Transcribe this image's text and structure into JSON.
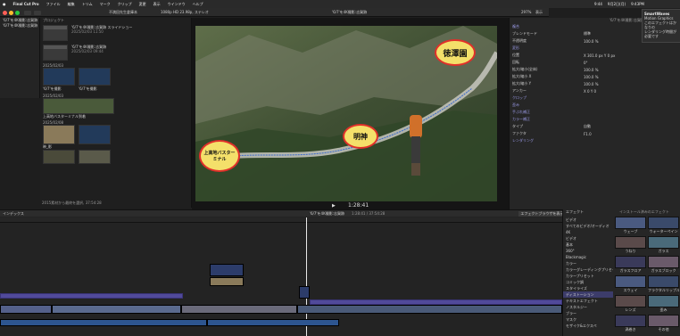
{
  "menubar": {
    "apple_icon": "apple-icon",
    "app": "Final Cut Pro",
    "items": [
      "ファイル",
      "編集",
      "トリム",
      "マーク",
      "クリップ",
      "変更",
      "表示",
      "ウインドウ",
      "ヘルプ"
    ],
    "status_items": [
      "9:44",
      "9月2日(月)",
      "9:43PM"
    ]
  },
  "toolbar": {
    "viewer_label": "不満田先生倉庫本",
    "resolution": "1080p HD 23.98p, ステレオ",
    "clip_title": "'6/7'を4K撮影:志賀跡",
    "zoom": "297%",
    "view_menu": "表示"
  },
  "library": {
    "items": [
      "'6/7'を4K撮影:志賀跡",
      "'6/7'を4K撮影:志賀跡"
    ]
  },
  "browser": {
    "section_project": "プロジェクト",
    "project_name": "'6/7'を4K撮影:志賀跡 スライドショー",
    "project_date": "2025/02/03 11:50",
    "project2_name": "'6/7'を4K撮影:志賀跡",
    "project2_date": "2025/02/03 09:44",
    "date_groups": [
      "2025/02/03",
      "2025/02/03",
      "2025/02/08"
    ],
    "clip_labels": [
      "'6/7'を撮影",
      "'6/7'を撮影",
      "上高地バスターミナル到着",
      "映_影"
    ],
    "footer": "2015素材から最終を選択, 37:54:28"
  },
  "viewer": {
    "label_tokusawa": "徳澤園",
    "label_myojin": "明神",
    "label_kamikochi": "上高地バスターミナル",
    "timecode": "1:28:41"
  },
  "inspector": {
    "title": "'6/7'を4K撮影:志賀跡",
    "rows": [
      {
        "label": "複合",
        "value": ""
      },
      {
        "label": "ブレンドモード",
        "value": "標準"
      },
      {
        "label": "不透明度",
        "value": "100.0 %"
      },
      {
        "label": "変形",
        "value": ""
      },
      {
        "label": "位置",
        "value": "X 301.0 px    Y 0 px"
      },
      {
        "label": "回転",
        "value": "0°"
      },
      {
        "label": "拡大/縮小(全体)",
        "value": "100.0 %"
      },
      {
        "label": "拡大/縮小 X",
        "value": "100.0 %"
      },
      {
        "label": "拡大/縮小 Y",
        "value": "100.0 %"
      },
      {
        "label": "アンカー",
        "value": "X 0    Y 0"
      },
      {
        "label": "クロップ",
        "value": ""
      },
      {
        "label": "歪み",
        "value": ""
      },
      {
        "label": "手ぶれ補正",
        "value": ""
      },
      {
        "label": "カラー補正",
        "value": ""
      },
      {
        "label": "タイプ",
        "value": "自動"
      },
      {
        "label": "ファクタ",
        "value": "F1.0"
      },
      {
        "label": "レンダリング",
        "value": ""
      }
    ],
    "popup_title": "SmartWaves",
    "popup_lines": [
      "SmartWaves",
      "Motion Graphics",
      "このエフェクトはかなりの",
      "レンダリング時間が必要です"
    ]
  },
  "timeline": {
    "index_label": "インデックス",
    "project_label": "'6/7'を4K撮影:志賀跡",
    "duration": "1:28:41 / 37:54:28",
    "right_label": "エフェクトブラウザを表示"
  },
  "effects": {
    "title": "エフェクト",
    "header_right": "インストール済みのエフェクト",
    "categories": [
      "ビデオ",
      "すべてのビデオ/オーディオ",
      "4K",
      "ビデオ",
      "基本",
      "360°",
      "Blackmagic",
      "カラー",
      "カラーグレーディングプリセット",
      "カラープリセット",
      "コミック調",
      "スタイライズ",
      "ディストーション",
      "テキストエフェクト",
      "ノスタルジー",
      "ブラー",
      "マスク",
      "モザイク&エクスペ"
    ],
    "selected_category": "ディストーション",
    "tiles": [
      "ウェーブ",
      "ウォーターペイン",
      "うねり",
      "ガラス",
      "ガラスフロア",
      "ガラスブロック",
      "スウェイ",
      "フラクタルリップル",
      "レンズ",
      "歪み",
      "渦巻き",
      "その他"
    ]
  },
  "colors": {
    "accent": "#6e6ee6",
    "clip_purple": "#514a9a",
    "audio_blue": "#3e6fb0",
    "selection": "#f0c43c"
  }
}
